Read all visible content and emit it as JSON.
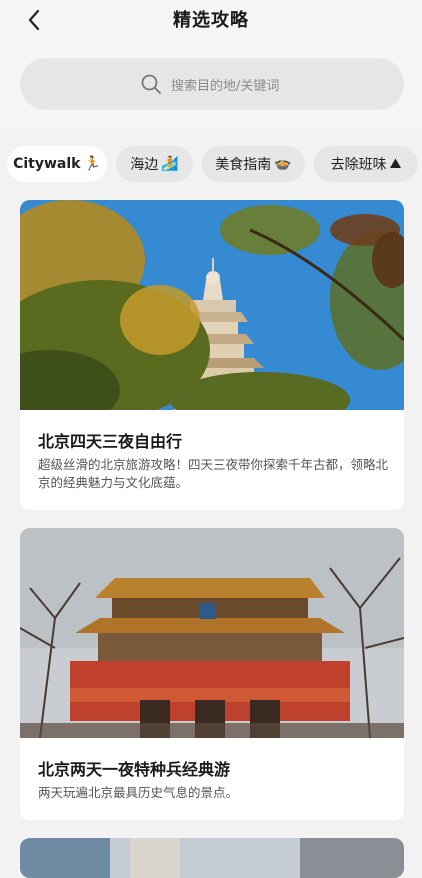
{
  "header": {
    "title": "精选攻略",
    "back_icon": "back-chevron-icon"
  },
  "search": {
    "placeholder": "搜索目的地/关键词",
    "icon": "search-icon"
  },
  "tabs": [
    {
      "label": "Citywalk",
      "emoji": "🏃",
      "active": true
    },
    {
      "label": "海边",
      "emoji": "🏄"
    },
    {
      "label": "美食指南",
      "emoji": "🍲"
    },
    {
      "label": "去除班味",
      "emoji": "⛰"
    }
  ],
  "cards": [
    {
      "title": "北京四天三夜自由行",
      "desc": "超级丝滑的北京旅游攻略！四天三夜带你探索千年古都，领略北京的经典魅力与文化底蕴。"
    },
    {
      "title": "北京两天一夜特种兵经典游",
      "desc": "两天玩遍北京最具历史气息的景点。"
    }
  ],
  "colors": {
    "background": "#f2f2f2",
    "card": "#ffffff",
    "chip": "#e6e6e6",
    "sky": "#3b8fd6"
  }
}
